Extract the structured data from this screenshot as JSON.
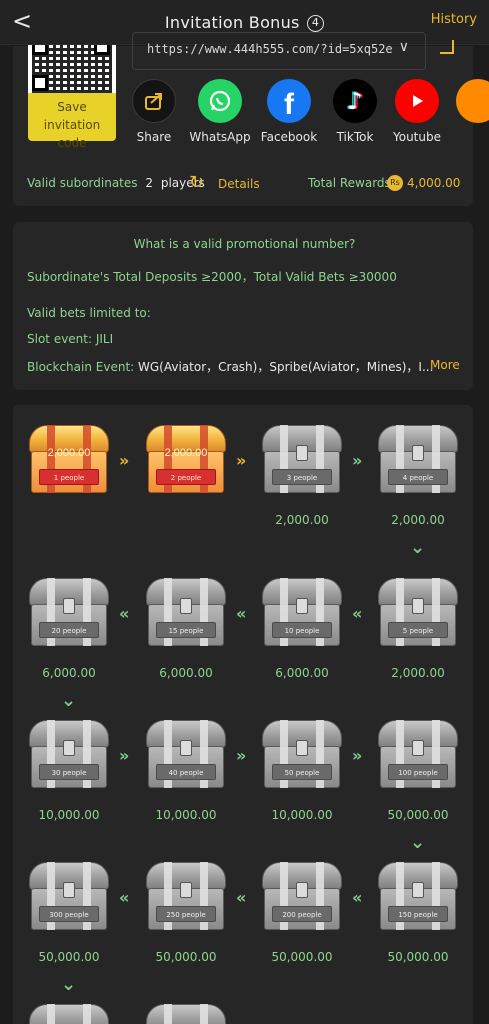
{
  "header": {
    "back": "<",
    "title": "Invitation Bonus",
    "badge": "4",
    "history": "History"
  },
  "share": {
    "url": "https://www.444h555.com/?id=5xq52e",
    "save_label_line1": "Save invitation",
    "save_label_line2": "code",
    "items": [
      {
        "label": "Share",
        "icon": "share-icon",
        "color": "#1c1c1c"
      },
      {
        "label": "WhatsApp",
        "icon": "whatsapp-icon",
        "color": "#25d366"
      },
      {
        "label": "Facebook",
        "icon": "facebook-icon",
        "color": "#1877f2"
      },
      {
        "label": "TikTok",
        "icon": "tiktok-icon",
        "color": "#000000"
      },
      {
        "label": "Youtube",
        "icon": "youtube-icon",
        "color": "#ff0000"
      }
    ],
    "valid_label": "Valid subordinates",
    "valid_count": "2",
    "valid_unit": "players",
    "details": "Details",
    "total_label": "Total Rewards",
    "total_value": "4,000.00",
    "currency": "Rs"
  },
  "promo": {
    "question": "What is a valid promotional number?",
    "condition": "Subordinate's Total Deposits ≥2000，Total Valid Bets ≥30000",
    "limited": "Valid bets limited to:",
    "slot": "Slot event: JILI",
    "blockchain_label": "Blockchain Event:",
    "blockchain_value": "WG(Aviator，Crash)，Spribe(Aviator，Mines)，I...",
    "more": "More"
  },
  "chests": [
    {
      "people": "1 people",
      "amount": "",
      "gold_amount": "2,000.00",
      "gold": true
    },
    {
      "people": "2 people",
      "amount": "",
      "gold_amount": "2,000.00",
      "gold": true
    },
    {
      "people": "3 people",
      "amount": "2,000.00"
    },
    {
      "people": "4 people",
      "amount": "2,000.00"
    },
    {
      "people": "5 people",
      "amount": "2,000.00"
    },
    {
      "people": "10 people",
      "amount": "6,000.00"
    },
    {
      "people": "15 people",
      "amount": "6,000.00"
    },
    {
      "people": "20 people",
      "amount": "6,000.00"
    },
    {
      "people": "30 people",
      "amount": "10,000.00"
    },
    {
      "people": "40 people",
      "amount": "10,000.00"
    },
    {
      "people": "50 people",
      "amount": "10,000.00"
    },
    {
      "people": "100 people",
      "amount": "50,000.00"
    },
    {
      "people": "150 people",
      "amount": "50,000.00"
    },
    {
      "people": "200 people",
      "amount": "50,000.00"
    },
    {
      "people": "250 people",
      "amount": "50,000.00"
    },
    {
      "people": "300 people",
      "amount": "50,000.00"
    }
  ],
  "arrows": {
    "right": "»",
    "left": "«",
    "down": "⌄"
  }
}
